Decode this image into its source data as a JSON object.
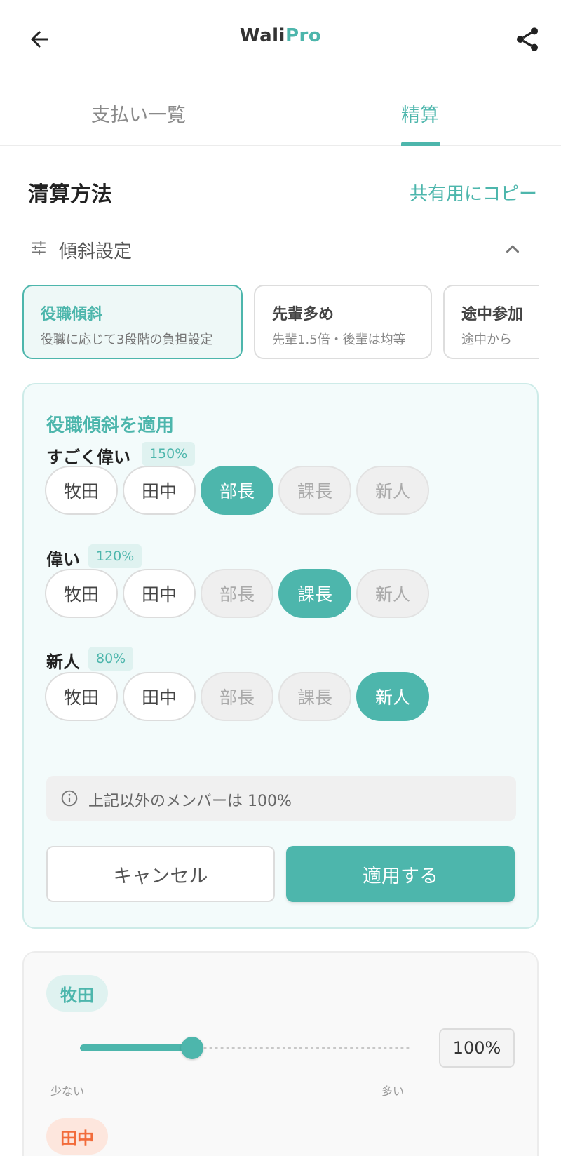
{
  "app": {
    "logo_main": "Wali",
    "logo_accent": "Pro",
    "accent_color": "#4db6ac"
  },
  "icons": {
    "back": "arrow-left-icon",
    "share": "share-icon",
    "tilt": "sliders-icon",
    "collapse": "chevron-up-icon",
    "info": "info-icon"
  },
  "tabs": [
    {
      "label": "支払い一覧",
      "active": false
    },
    {
      "label": "精算",
      "active": true
    }
  ],
  "section": {
    "title": "清算方法",
    "copy_label": "共有用にコピー",
    "tilt_label": "傾斜設定"
  },
  "presets": [
    {
      "title": "役職傾斜",
      "desc": "役職に応じて3段階の負担設定",
      "active": true
    },
    {
      "title": "先輩多め",
      "desc": "先輩1.5倍・後輩は均等",
      "active": false
    },
    {
      "title": "途中参加",
      "desc": "途中から",
      "active": false
    }
  ],
  "panel": {
    "title": "役職傾斜を適用",
    "tiers": [
      {
        "label": "すごく偉い",
        "pct": "150%",
        "chips": [
          {
            "label": "牧田",
            "state": "avail"
          },
          {
            "label": "田中",
            "state": "avail"
          },
          {
            "label": "部長",
            "state": "sel"
          },
          {
            "label": "課長",
            "state": "dis"
          },
          {
            "label": "新人",
            "state": "dis"
          }
        ]
      },
      {
        "label": "偉い",
        "pct": "120%",
        "chips": [
          {
            "label": "牧田",
            "state": "avail"
          },
          {
            "label": "田中",
            "state": "avail"
          },
          {
            "label": "部長",
            "state": "dis"
          },
          {
            "label": "課長",
            "state": "sel"
          },
          {
            "label": "新人",
            "state": "dis"
          }
        ]
      },
      {
        "label": "新人",
        "pct": "80%",
        "chips": [
          {
            "label": "牧田",
            "state": "avail"
          },
          {
            "label": "田中",
            "state": "avail"
          },
          {
            "label": "部長",
            "state": "dis"
          },
          {
            "label": "課長",
            "state": "dis"
          },
          {
            "label": "新人",
            "state": "sel"
          }
        ]
      }
    ],
    "note": "上記以外のメンバーは 100%",
    "cancel_label": "キャンセル",
    "apply_label": "適用する"
  },
  "members": [
    {
      "name": "牧田",
      "badge_color": "#4db6ac",
      "badge_bg": "#dff2f0",
      "value_pct": "100%",
      "slider_fraction": 0.34,
      "min_label": "少ない",
      "max_label": "多い"
    },
    {
      "name": "田中",
      "badge_color": "#f26b3a",
      "badge_bg": "#fde6dd"
    }
  ]
}
